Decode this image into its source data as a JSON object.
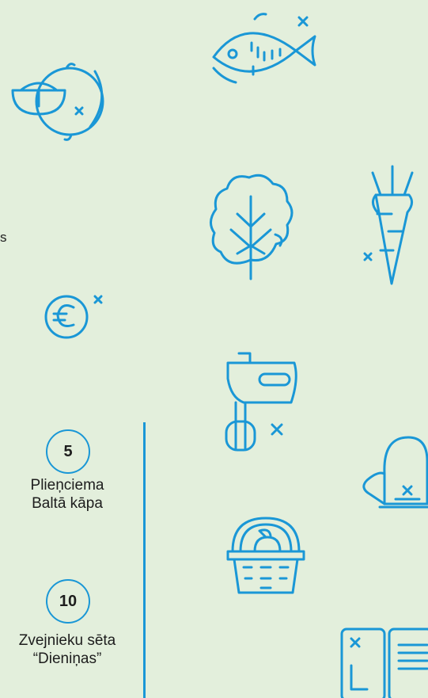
{
  "cut_text": "s",
  "stops": [
    {
      "number": "5",
      "name_line1": "Plieņciema",
      "name_line2": "Baltā kāpa"
    },
    {
      "number": "10",
      "name_line1": "Zvejnieku sēta",
      "name_line2": "“Dieniņas”"
    }
  ],
  "colors": {
    "background": "#e3efdc",
    "accent": "#1a97d6",
    "text": "#1d1d1d"
  },
  "icons": [
    "lemon-icon",
    "fish-icon",
    "lettuce-icon",
    "carrot-icon",
    "euro-coin-icon",
    "hand-mixer-icon",
    "oven-mitt-icon",
    "fruit-basket-icon",
    "open-book-icon"
  ]
}
